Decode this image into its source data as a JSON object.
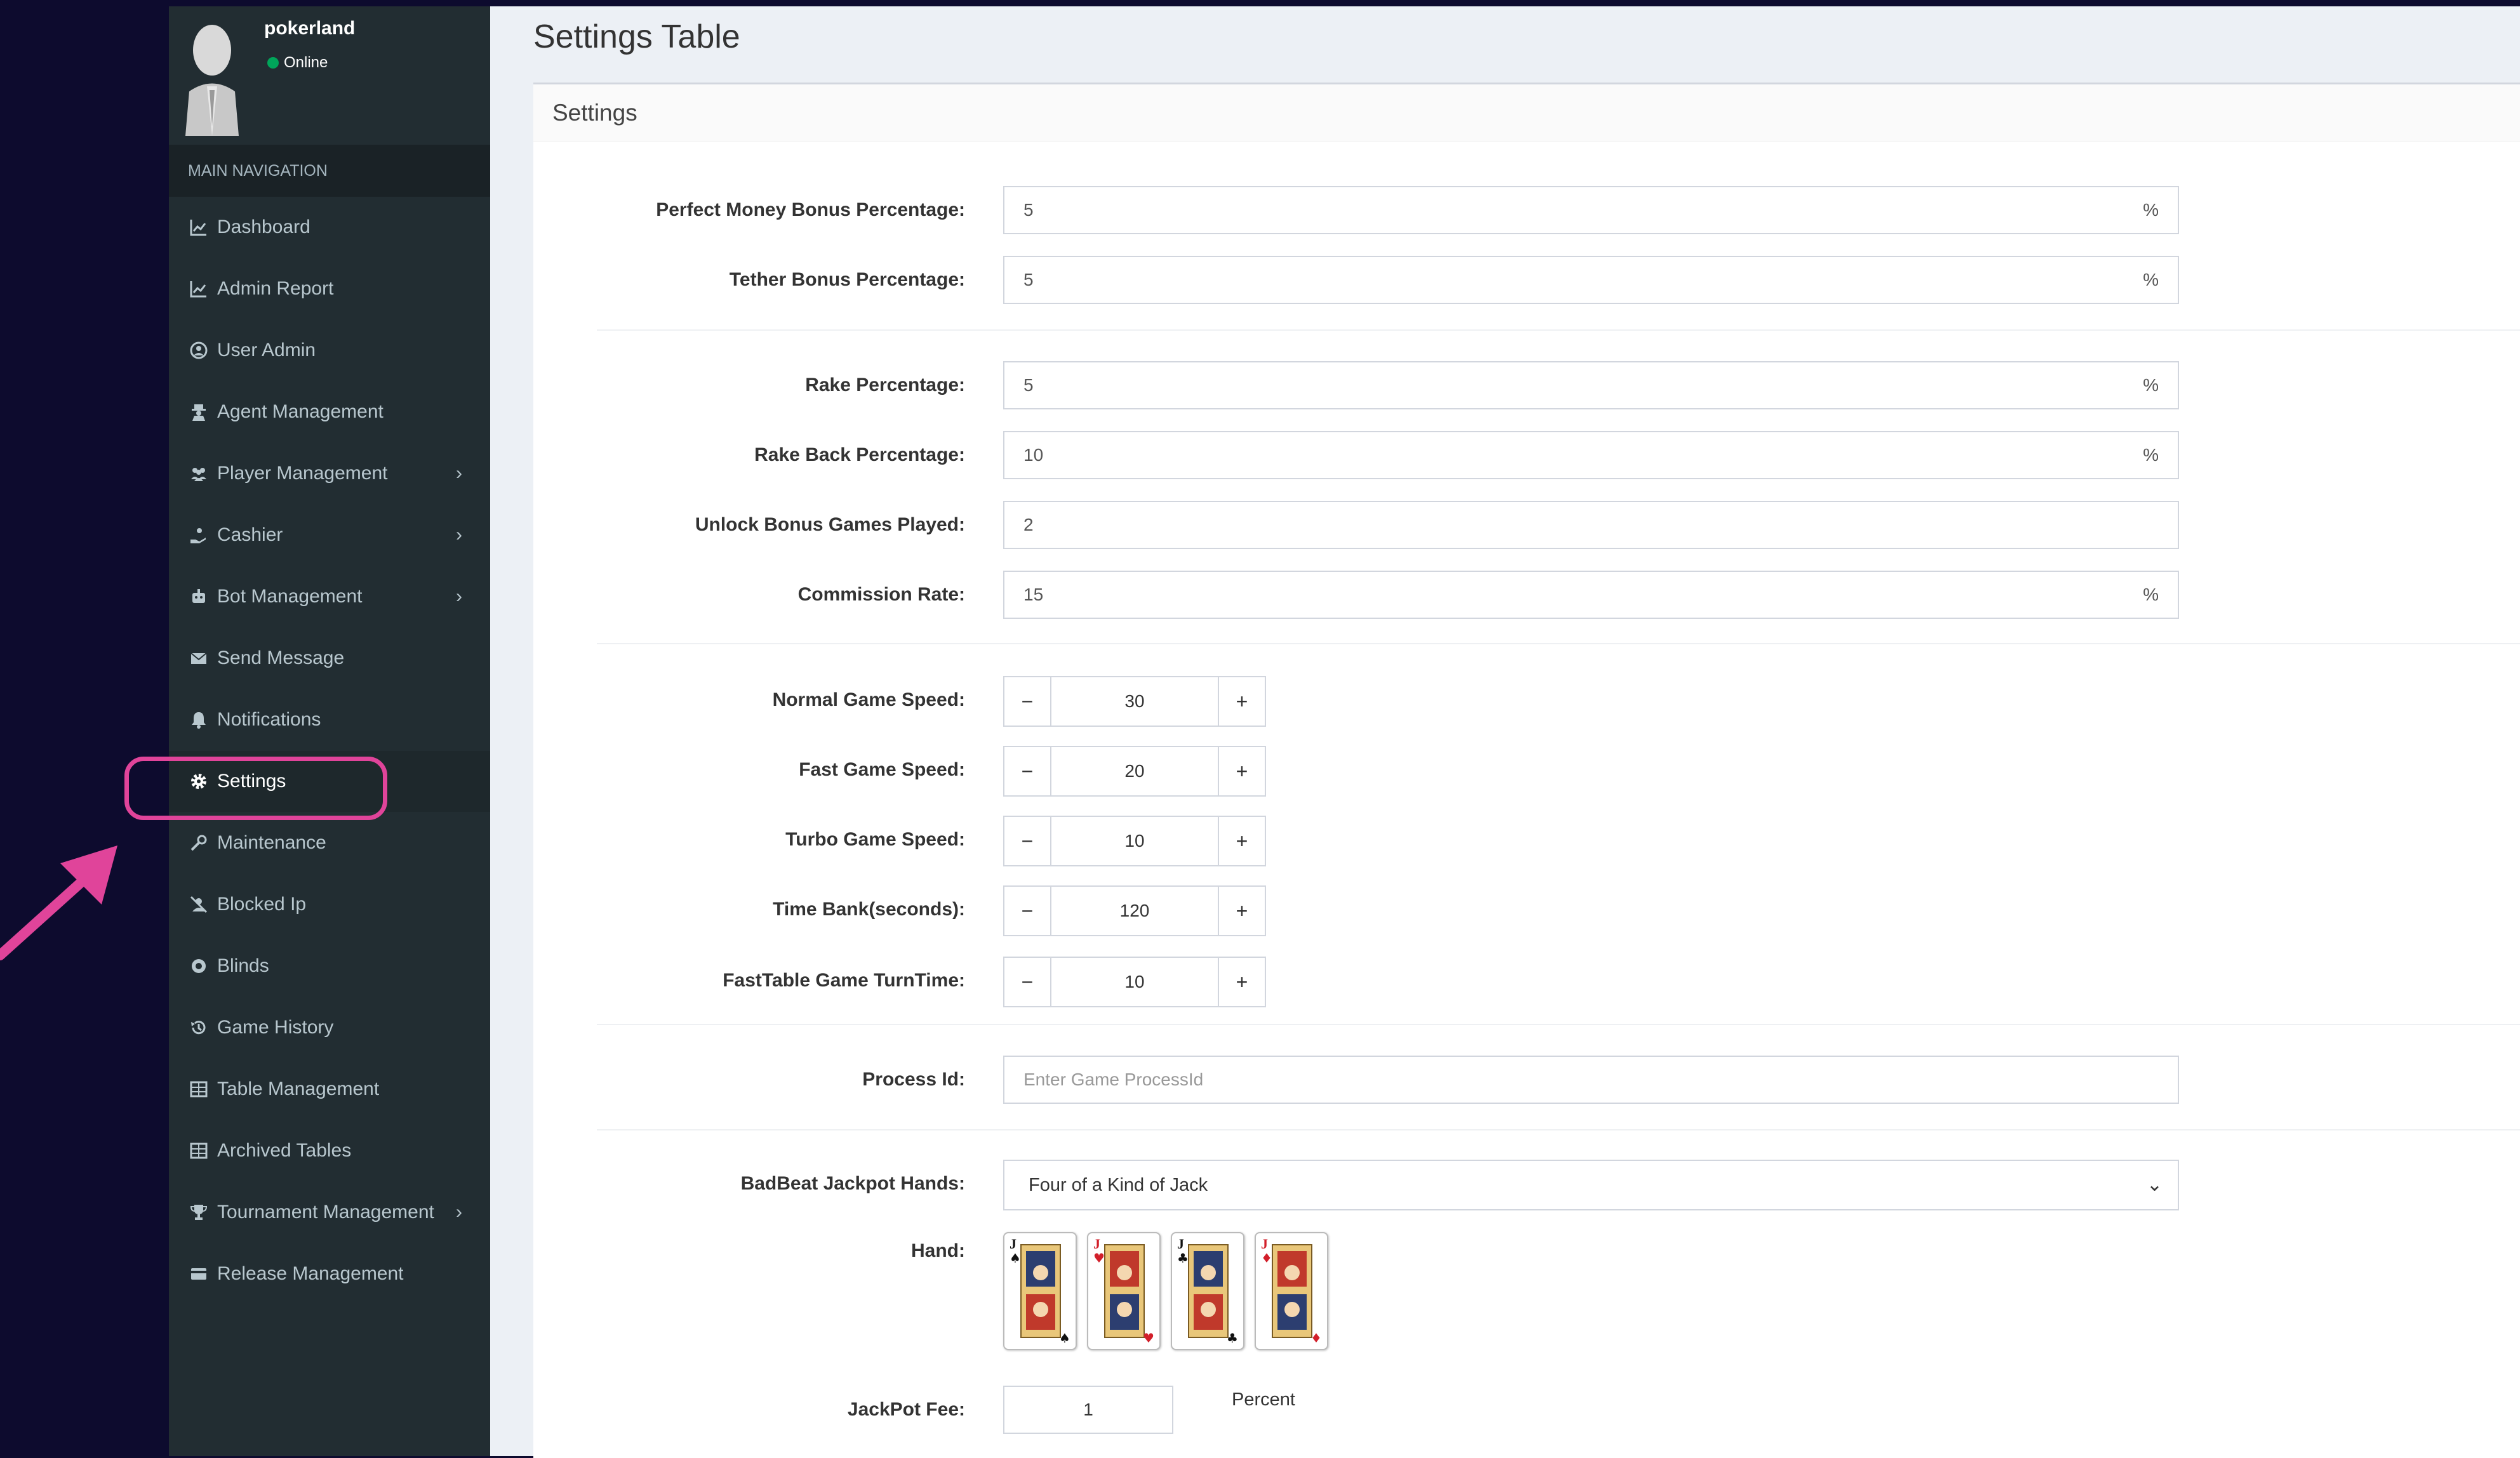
{
  "user": {
    "name": "pokerland",
    "status": "Online"
  },
  "sidebar": {
    "header": "MAIN NAVIGATION",
    "items": [
      {
        "label": "Dashboard",
        "icon": "line-chart-icon",
        "submenu": false
      },
      {
        "label": "Admin Report",
        "icon": "line-chart-icon",
        "submenu": false
      },
      {
        "label": "User Admin",
        "icon": "user-circle-icon",
        "submenu": false
      },
      {
        "label": "Agent Management",
        "icon": "user-secret-icon",
        "submenu": false
      },
      {
        "label": "Player Management",
        "icon": "users-icon",
        "submenu": true
      },
      {
        "label": "Cashier",
        "icon": "hand-holding-icon",
        "submenu": true
      },
      {
        "label": "Bot Management",
        "icon": "robot-icon",
        "submenu": true
      },
      {
        "label": "Send Message",
        "icon": "envelope-icon",
        "submenu": false
      },
      {
        "label": "Notifications",
        "icon": "bell-icon",
        "submenu": false
      },
      {
        "label": "Settings",
        "icon": "gear-icon",
        "submenu": false,
        "active": true
      },
      {
        "label": "Maintenance",
        "icon": "wrench-icon",
        "submenu": false
      },
      {
        "label": "Blocked Ip",
        "icon": "blocked-user-icon",
        "submenu": false
      },
      {
        "label": "Blinds",
        "icon": "blinds-icon",
        "submenu": false
      },
      {
        "label": "Game History",
        "icon": "history-icon",
        "submenu": false
      },
      {
        "label": "Table Management",
        "icon": "table-icon",
        "submenu": false
      },
      {
        "label": "Archived Tables",
        "icon": "table-icon",
        "submenu": false
      },
      {
        "label": "Tournament Management",
        "icon": "trophy-icon",
        "submenu": true
      },
      {
        "label": "Release Management",
        "icon": "credit-card-icon",
        "submenu": false
      }
    ]
  },
  "page": {
    "title": "Settings Table",
    "box_title": "Settings"
  },
  "form": {
    "perfect_money_bonus": {
      "label": "Perfect Money Bonus Percentage:",
      "value": "5",
      "suffix": "%"
    },
    "tether_bonus": {
      "label": "Tether Bonus Percentage:",
      "value": "5",
      "suffix": "%"
    },
    "rake": {
      "label": "Rake Percentage:",
      "value": "5",
      "suffix": "%"
    },
    "rake_back": {
      "label": "Rake Back Percentage:",
      "value": "10",
      "suffix": "%"
    },
    "unlock_bonus": {
      "label": "Unlock Bonus Games Played:",
      "value": "2"
    },
    "commission": {
      "label": "Commission Rate:",
      "value": "15",
      "suffix": "%"
    },
    "normal_speed": {
      "label": "Normal Game Speed:",
      "value": "30"
    },
    "fast_speed": {
      "label": "Fast Game Speed:",
      "value": "20"
    },
    "turbo_speed": {
      "label": "Turbo Game Speed:",
      "value": "10"
    },
    "time_bank": {
      "label": "Time Bank(seconds):",
      "value": "120"
    },
    "fasttable_turn": {
      "label": "FastTable Game TurnTime:",
      "value": "10"
    },
    "process_id": {
      "label": "Process Id:",
      "placeholder": "Enter Game ProcessId"
    },
    "badbeat": {
      "label": "BadBeat Jackpot Hands:",
      "selected": "Four of a Kind of Jack"
    },
    "hand": {
      "label": "Hand:",
      "cards": [
        "J♠",
        "J♥",
        "J♣",
        "J♦"
      ]
    },
    "jackpot_fee": {
      "label": "JackPot Fee:",
      "value": "1",
      "unit": "Percent"
    },
    "stepper_minus": "−",
    "stepper_plus": "+"
  },
  "colors": {
    "highlight": "#e0449a",
    "sidebar_bg": "#222d32",
    "online": "#00a65a"
  }
}
